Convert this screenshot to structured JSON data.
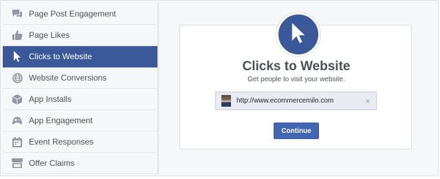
{
  "sidebar": {
    "items": [
      {
        "label": "Page Post Engagement",
        "icon": "comments-icon"
      },
      {
        "label": "Page Likes",
        "icon": "thumbs-up-icon"
      },
      {
        "label": "Clicks to Website",
        "icon": "cursor-icon",
        "active": true
      },
      {
        "label": "Website Conversions",
        "icon": "globe-icon"
      },
      {
        "label": "App Installs",
        "icon": "cube-icon"
      },
      {
        "label": "App Engagement",
        "icon": "gamepad-icon"
      },
      {
        "label": "Event Responses",
        "icon": "calendar-icon"
      },
      {
        "label": "Offer Claims",
        "icon": "offer-store-icon"
      }
    ]
  },
  "main": {
    "icon": "cursor-icon",
    "title": "Clicks to Website",
    "subtitle": "Get people to visit your website.",
    "url_value": "http://www.ecommercemilo.com",
    "remove_glyph": "×",
    "continue_label": "Continue"
  },
  "colors": {
    "accent": "#3b5998",
    "button": "#4267b2",
    "text": "#4b4f56"
  }
}
